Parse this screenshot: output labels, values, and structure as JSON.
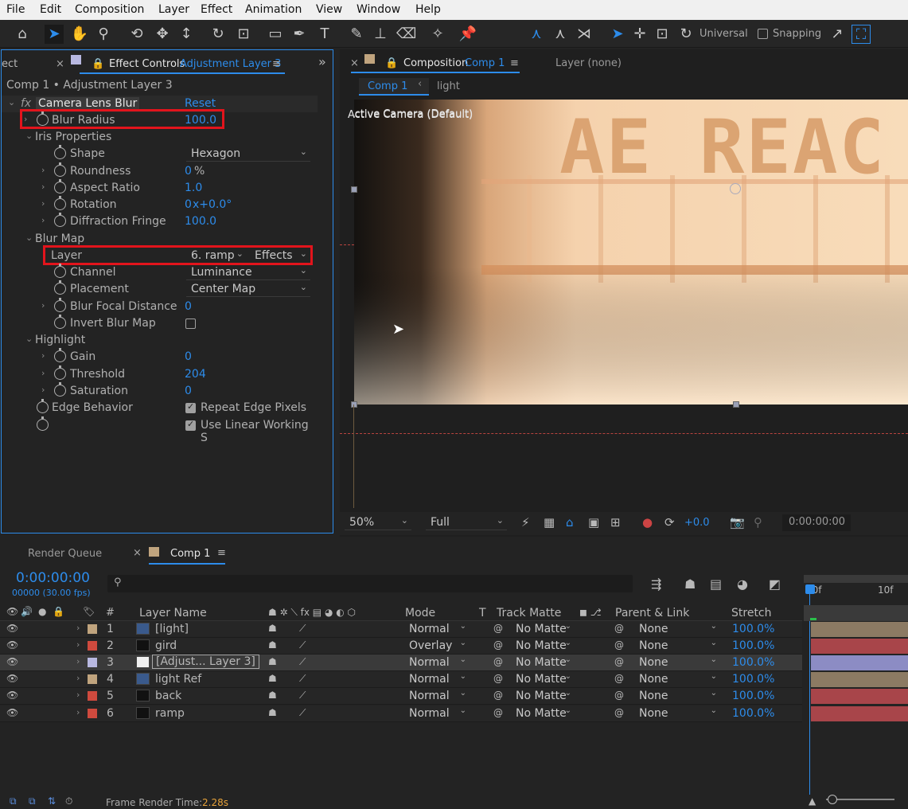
{
  "menu": [
    "File",
    "Edit",
    "Composition",
    "Layer",
    "Effect",
    "Animation",
    "View",
    "Window",
    "Help"
  ],
  "toolbar": {
    "universal": "Universal",
    "snapping": "Snapping"
  },
  "effect_controls": {
    "tab_prev": "ect",
    "tab_label": "Effect Controls",
    "tab_layer": "Adjustment Layer 3",
    "breadcrumb": "Comp 1 • Adjustment Layer 3",
    "fx": "fx",
    "effect_name": "Camera Lens Blur",
    "reset": "Reset",
    "blur_radius_label": "Blur Radius",
    "blur_radius_value": "100.0",
    "iris_label": "Iris Properties",
    "shape_label": "Shape",
    "shape_value": "Hexagon",
    "roundness_label": "Roundness",
    "roundness_value": "0",
    "roundness_unit": "%",
    "aspect_label": "Aspect Ratio",
    "aspect_value": "1.0",
    "rotation_label": "Rotation",
    "rotation_value": "0",
    "rotation_suffix": "x+0.0°",
    "diffraction_label": "Diffraction Fringe",
    "diffraction_value": "100.0",
    "blurmap_label": "Blur Map",
    "layer_label": "Layer",
    "layer_value": "6. ramp",
    "layer_source": "Effects &",
    "channel_label": "Channel",
    "channel_value": "Luminance",
    "placement_label": "Placement",
    "placement_value": "Center Map",
    "focal_label": "Blur Focal Distance",
    "focal_value": "0",
    "invert_label": "Invert Blur Map",
    "highlight_label": "Highlight",
    "gain_label": "Gain",
    "gain_value": "0",
    "threshold_label": "Threshold",
    "threshold_value": "204",
    "saturation_label": "Saturation",
    "saturation_value": "0",
    "edge_label": "Edge Behavior",
    "repeat_label": "Repeat Edge Pixels",
    "linear_label": "Use Linear Working S"
  },
  "composition": {
    "tab_label": "Composition",
    "tab_comp": "Comp 1",
    "layer_tab": "Layer (none)",
    "nav_comp": "Comp 1",
    "nav_light": "light",
    "active_camera": "Active Camera (Default)",
    "viewer_text": "AE REAC",
    "zoom": "50%",
    "resolution": "Full",
    "exposure": "+0.0",
    "timecode": "0:00:00:00"
  },
  "timeline": {
    "render_queue": "Render Queue",
    "comp_tab": "Comp 1",
    "timecode": "0:00:00:00",
    "frame_info": "00000 (30.00 fps)",
    "search_placeholder": "",
    "columns": {
      "num": "#",
      "layer_name": "Layer Name",
      "mode": "Mode",
      "t": "T",
      "track_matte": "Track Matte",
      "parent": "Parent & Link",
      "stretch": "Stretch"
    },
    "ruler_start": "00f",
    "ruler_10": "10f",
    "layers": [
      {
        "num": "1",
        "name": "[light]",
        "mode": "Normal",
        "matte": "No Matte",
        "parent": "None",
        "stretch": "100.0%",
        "color": "#c0a47e",
        "bar": "#8c7a63"
      },
      {
        "num": "2",
        "name": "gird",
        "mode": "Overlay",
        "matte": "No Matte",
        "parent": "None",
        "stretch": "100.0%",
        "color": "#cf4a3e",
        "bar": "#a8454a"
      },
      {
        "num": "3",
        "name": "[Adjust... Layer 3]",
        "mode": "Normal",
        "matte": "No Matte",
        "parent": "None",
        "stretch": "100.0%",
        "color": "#b8b8e0",
        "bar": "#8c8cc4"
      },
      {
        "num": "4",
        "name": "light Ref",
        "mode": "Normal",
        "matte": "No Matte",
        "parent": "None",
        "stretch": "100.0%",
        "color": "#c0a47e",
        "bar": "#8c7a63"
      },
      {
        "num": "5",
        "name": "back",
        "mode": "Normal",
        "matte": "No Matte",
        "parent": "None",
        "stretch": "100.0%",
        "color": "#cf4a3e",
        "bar": "#a8454a"
      },
      {
        "num": "6",
        "name": "ramp",
        "mode": "Normal",
        "matte": "No Matte",
        "parent": "None",
        "stretch": "100.0%",
        "color": "#cf4a3e",
        "bar": "#a8454a"
      }
    ]
  },
  "status": {
    "frame_render_label": "Frame Render Time:",
    "frame_render_value": "2.28s"
  },
  "colors": {
    "accent": "#2d8ceb",
    "highlight_red": "#e2141c",
    "render_time": "#e8a33a"
  }
}
